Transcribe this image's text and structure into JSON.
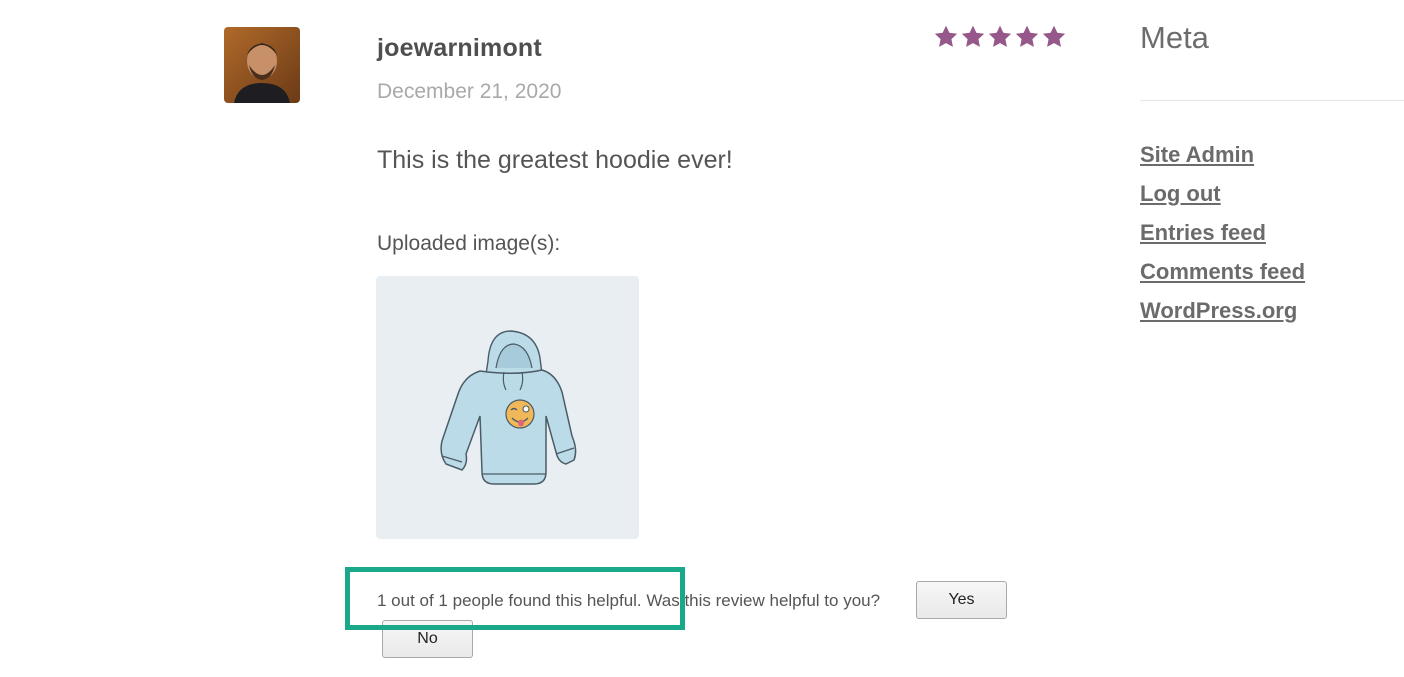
{
  "review": {
    "author": "joewarnimont",
    "date": "December 21, 2020",
    "rating": 5,
    "text": "This is the greatest hoodie ever!",
    "uploaded_label": "Uploaded image(s):",
    "helpful_text": "1 out of 1 people found this helpful. Was this review helpful to you?",
    "yes_label": "Yes",
    "no_label": "No",
    "star_color": "#96588a"
  },
  "sidebar": {
    "title": "Meta",
    "links": [
      {
        "label": "Site Admin"
      },
      {
        "label": "Log out"
      },
      {
        "label": "Entries feed"
      },
      {
        "label": "Comments feed"
      },
      {
        "label": "WordPress.org"
      }
    ]
  },
  "highlight_color": "#19a889"
}
